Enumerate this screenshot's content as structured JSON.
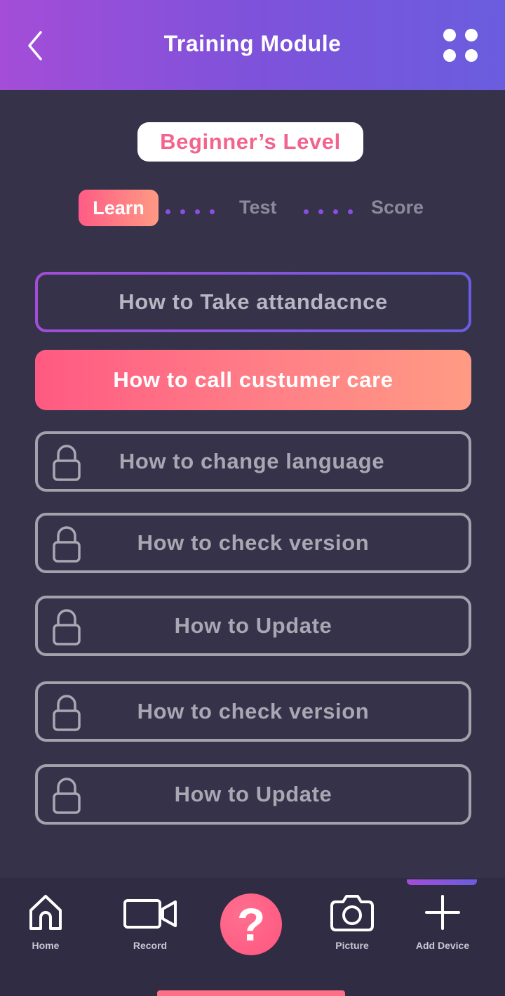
{
  "header": {
    "title": "Training Module",
    "back_icon": "chevron-left-icon",
    "menu_icon": "grid-dots-icon"
  },
  "level": {
    "label": "Beginner’s Level"
  },
  "steps": [
    {
      "label": "Learn",
      "active": true
    },
    {
      "label": "Test",
      "active": false
    },
    {
      "label": "Score",
      "active": false
    }
  ],
  "lessons": [
    {
      "label": "How to Take attandacnce",
      "state": "current"
    },
    {
      "label": "How to call custumer care",
      "state": "highlighted"
    },
    {
      "label": "How to change language",
      "state": "locked"
    },
    {
      "label": "How to check version",
      "state": "locked"
    },
    {
      "label": "How to Update",
      "state": "locked"
    },
    {
      "label": "How to check version",
      "state": "locked"
    },
    {
      "label": "How to Update",
      "state": "locked"
    }
  ],
  "nav": {
    "home": {
      "label": "Home",
      "icon": "home-icon"
    },
    "record": {
      "label": "Record",
      "icon": "video-camera-icon"
    },
    "help": {
      "label": "?",
      "icon": "help-icon"
    },
    "picture": {
      "label": "Picture",
      "icon": "camera-icon"
    },
    "add_device": {
      "label": "Add Device",
      "icon": "plus-icon",
      "active": true
    }
  },
  "colors": {
    "accent_pink": "#ff5c85",
    "accent_purple": "#8b4ee0",
    "background": "#35324a"
  }
}
